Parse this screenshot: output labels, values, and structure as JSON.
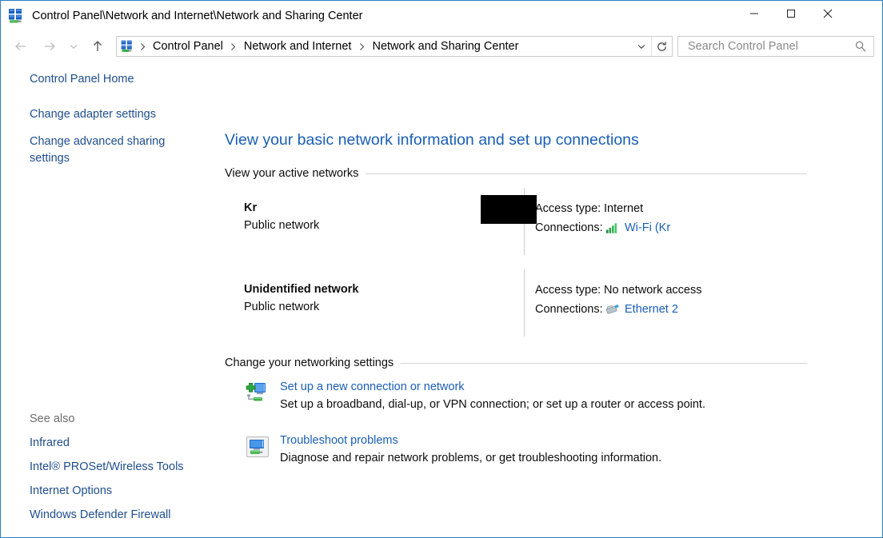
{
  "window": {
    "title": "Control Panel\\Network and Internet\\Network and Sharing Center",
    "title_icon": "network-sharing-center-icon",
    "minimize_label": "Minimize",
    "maximize_label": "Maximize",
    "close_label": "Close",
    "border_color": "#2c7fc4"
  },
  "nav": {
    "back_label": "Back",
    "forward_label": "Forward",
    "recent_label": "Recent locations",
    "up_label": "Up one level",
    "refresh_label": "Refresh",
    "address_icon": "network-sharing-center-icon",
    "breadcrumbs": [
      "Control Panel",
      "Network and Internet",
      "Network and Sharing Center"
    ]
  },
  "search": {
    "placeholder": "Search Control Panel",
    "value": "",
    "icon": "search-icon"
  },
  "sidebar": {
    "tasks": [
      {
        "label": "Control Panel Home"
      },
      {
        "label": "Change adapter settings"
      },
      {
        "label": "Change advanced sharing settings"
      }
    ],
    "see_also_label": "See also",
    "see_also": [
      {
        "label": "Infrared"
      },
      {
        "label": "Intel® PROSet/Wireless Tools"
      },
      {
        "label": "Internet Options"
      },
      {
        "label": "Windows Defender Firewall"
      }
    ]
  },
  "content": {
    "heading": "View your basic network information and set up connections",
    "active_networks_header": "View your active networks",
    "change_settings_header": "Change your networking settings",
    "networks": [
      {
        "name": "Kr",
        "name_redacted": true,
        "type": "Public network",
        "access_type_label": "Access type:",
        "access_type_value": "Internet",
        "connections_label": "Connections:",
        "connection_icon": "wifi-signal-icon",
        "connection_name": "Wi-Fi (Kr",
        "connection_redacted": true
      },
      {
        "name": "Unidentified network",
        "name_redacted": false,
        "type": "Public network",
        "access_type_label": "Access type:",
        "access_type_value": "No network access",
        "connections_label": "Connections:",
        "connection_icon": "ethernet-icon",
        "connection_name": "Ethernet 2",
        "connection_redacted": false
      }
    ],
    "settings": [
      {
        "icon": "new-connection-icon",
        "title": "Set up a new connection or network",
        "description": "Set up a broadband, dial-up, or VPN connection; or set up a router or access point."
      },
      {
        "icon": "troubleshoot-icon",
        "title": "Troubleshoot problems",
        "description": "Diagnose and repair network problems, or get troubleshooting information."
      }
    ]
  },
  "colors": {
    "link": "#1a5fb4",
    "sidebar_link": "#1f4e8c",
    "heading": "#1a5fb4",
    "text": "#0d0d0d",
    "muted": "#6b6b6b",
    "redaction": "#000000"
  }
}
